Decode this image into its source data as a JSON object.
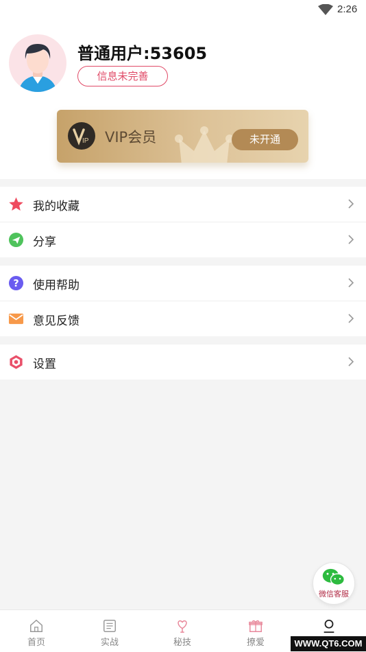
{
  "status_bar": {
    "time": "2:26"
  },
  "profile": {
    "username": "普通用户:53605",
    "info_button": "信息未完善"
  },
  "vip": {
    "title": "VIP会员",
    "button": "未开通",
    "accent": "#b38a55"
  },
  "menu_groups": [
    {
      "items": [
        {
          "label": "我的收藏",
          "icon": "star-icon"
        },
        {
          "label": "分享",
          "icon": "paper-plane-icon"
        }
      ]
    },
    {
      "items": [
        {
          "label": "使用帮助",
          "icon": "question-icon"
        },
        {
          "label": "意见反馈",
          "icon": "mail-icon"
        }
      ]
    },
    {
      "items": [
        {
          "label": "设置",
          "icon": "hexagon-gear-icon"
        }
      ]
    }
  ],
  "wechat": {
    "label": "微信客服"
  },
  "tabbar": {
    "tabs": [
      {
        "label": "首页",
        "icon": "home-icon"
      },
      {
        "label": "实战",
        "icon": "list-icon"
      },
      {
        "label": "秘技",
        "icon": "heart-flower-icon"
      },
      {
        "label": "撩爱",
        "icon": "gift-icon"
      },
      {
        "label": "",
        "icon": "person-icon",
        "active": true
      }
    ]
  },
  "watermark": "WWW.QT6.COM",
  "colors": {
    "primary": "#e04a67",
    "vip_gold": "#c6a26a"
  }
}
